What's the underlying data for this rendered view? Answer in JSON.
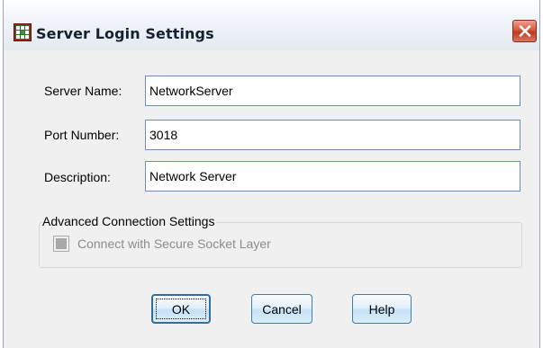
{
  "window": {
    "title": "Server Login Settings",
    "icon": "spss-grid-icon",
    "close_icon": "close-icon"
  },
  "form": {
    "server_name": {
      "label": "Server Name:",
      "value": "NetworkServer"
    },
    "port_number": {
      "label": "Port Number:",
      "value": "3018"
    },
    "description": {
      "label": "Description:",
      "value": "Network Server"
    }
  },
  "advanced": {
    "legend": "Advanced Connection Settings",
    "ssl": {
      "label": "Connect with Secure Socket Layer",
      "checked": false,
      "enabled": false
    }
  },
  "buttons": {
    "ok": "OK",
    "cancel": "Cancel",
    "help": "Help"
  },
  "colors": {
    "close_red": "#c0391f",
    "input_border": "#6d8fb8",
    "button_border": "#3c7fb1",
    "disabled_text": "#8c8c8c"
  }
}
